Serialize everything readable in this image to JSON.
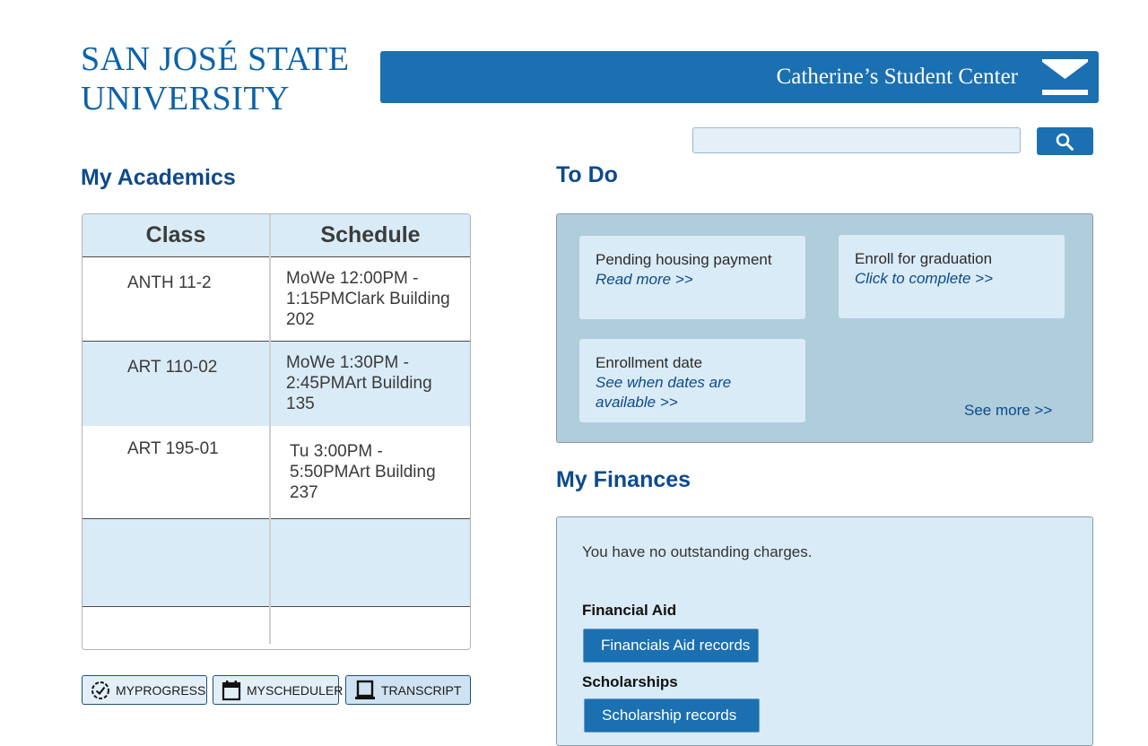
{
  "logo": {
    "line1": "SAN JOSÉ STATE",
    "line2": "UNIVERSITY"
  },
  "header": {
    "title": "Catherine’s Student Center",
    "mail_icon": "envelope-icon"
  },
  "search": {
    "value": "",
    "placeholder": "",
    "icon": "magnifier-icon"
  },
  "academics": {
    "title": "My Academics",
    "columns": [
      "Class",
      "Schedule"
    ],
    "rows": [
      {
        "class": "ANTH 11-2",
        "schedule": "MoWe 12:00PM - 1:15PMClark Building 202"
      },
      {
        "class": "ART 110-02",
        "schedule": "MoWe 1:30PM - 2:45PMArt Building 135"
      },
      {
        "class": "ART 195-01",
        "schedule": "Tu 3:00PM - 5:50PMArt Building 237"
      }
    ],
    "buttons": [
      {
        "label": "MYPROGRESS",
        "icon": "progress-check-icon"
      },
      {
        "label": "MYSCHEDULER",
        "icon": "calendar-icon"
      },
      {
        "label": "TRANSCRIPT",
        "icon": "laptop-icon"
      }
    ]
  },
  "todo": {
    "title": "To Do",
    "items": [
      {
        "title": "Pending housing payment",
        "link": "Read more >>"
      },
      {
        "title": "Enroll for graduation",
        "link": "Click to complete >>"
      },
      {
        "title": "Enrollment date",
        "link": "See when dates are available >>"
      }
    ],
    "see_more": "See more >>"
  },
  "finances": {
    "title": "My Finances",
    "note": "You have no outstanding charges.",
    "aid_label": "Financial Aid",
    "aid_button": "Financials Aid records",
    "scholarship_label": "Scholarships",
    "scholarship_button": "Scholarship records"
  },
  "colors": {
    "brand_blue": "#1a70b1",
    "heading_blue": "#0d4a8c",
    "light_blue": "#d9ebf6",
    "todo_panel": "#b0cddb"
  }
}
